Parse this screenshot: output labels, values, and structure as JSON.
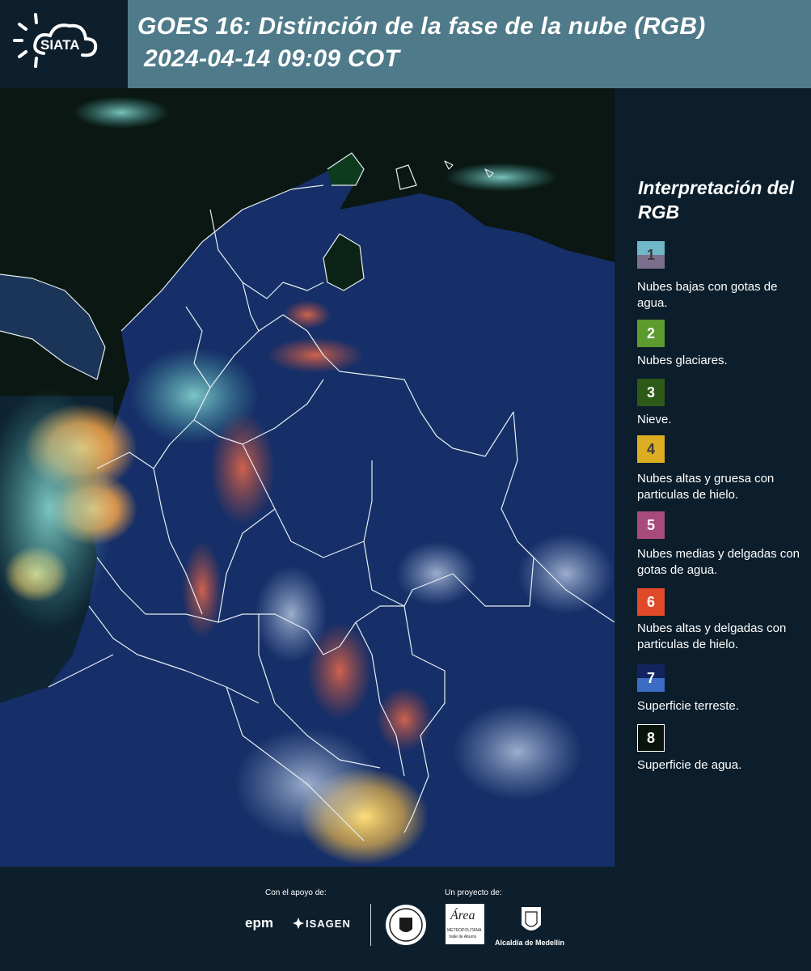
{
  "header": {
    "logo_text": "SIATA",
    "title_line1": "GOES 16: Distinción de la fase de la nube (RGB)",
    "title_line2": "2024-04-14 09:09 COT"
  },
  "legend": {
    "title": "Interpretación del RGB",
    "items": [
      {
        "number": "1",
        "label": "Nubes bajas con gotas de agua.",
        "color_top": "#6fb7c9",
        "color_bottom": "#7b6f8d"
      },
      {
        "number": "2",
        "label": "Nubes glaciares.",
        "color": "#5c9b2e"
      },
      {
        "number": "3",
        "label": "Nieve.",
        "color": "#2e5a18"
      },
      {
        "number": "4",
        "label": "Nubes altas y gruesa con particulas de hielo.",
        "color": "#dcad20"
      },
      {
        "number": "5",
        "label": "Nubes medias y delgadas con gotas de agua.",
        "color": "#a84a7c"
      },
      {
        "number": "6",
        "label": "Nubes altas y delgadas con particulas de hielo.",
        "color": "#e04a2a"
      },
      {
        "number": "7",
        "label": "Superficie terreste.",
        "color_top": "#13235f",
        "color_bottom": "#3d6cc4"
      },
      {
        "number": "8",
        "label": "Superficie de agua.",
        "color": "#08140c"
      }
    ]
  },
  "footer": {
    "support_caption": "Con el apoyo de:",
    "project_caption": "Un proyecto de:",
    "sponsors": [
      "epm",
      "ISAGEN"
    ],
    "project_logos": [
      "Área Metropolitana Valle de Aburrá",
      "Alcaldía de Medellín"
    ],
    "area_logo_text": "Área",
    "area_logo_subtext": "METROPOLITANA",
    "area_logo_subtext2": "Valle de Aburrá",
    "alcaldia_text": "Alcaldía de Medellín"
  },
  "colors": {
    "header_bg": "#4f7a8a",
    "page_bg": "#0d1f2d",
    "ocean": "#0a1712",
    "land": "#16306a"
  },
  "icons": [
    "siata-sun-cloud-icon",
    "epm-logo",
    "isagen-logo",
    "medellin-seal-icon",
    "area-metropolitana-logo",
    "alcaldia-shield-icon"
  ]
}
